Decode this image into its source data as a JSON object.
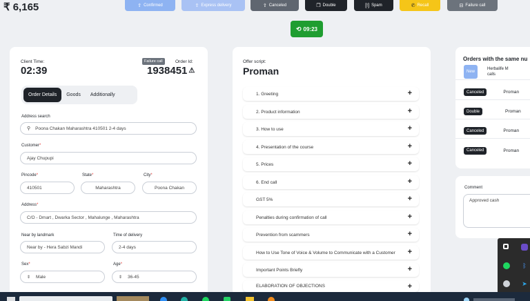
{
  "header": {
    "balance": "₹ 6,165",
    "buttons": {
      "confirmed": {
        "label": "Confirmed",
        "color": "#8eb3f2"
      },
      "express": {
        "label": "Express delivery",
        "color": "#a9c2f4"
      },
      "canceled": {
        "label": "Canceled",
        "color": "#5f6670"
      },
      "double": {
        "label": "Double",
        "color": "#1f2329"
      },
      "spam": {
        "label": "Spam",
        "color": "#1f2329"
      },
      "recall": {
        "label": "Recall",
        "color": "#f5c518"
      },
      "failure": {
        "label": "Failure call",
        "color": "#6c737c"
      }
    },
    "timer": "09:23",
    "timer_color": "#1f9d30"
  },
  "order_card": {
    "client_time_label": "Client Time:",
    "client_time": "02:39",
    "failure_badge": "Failure call",
    "order_id_label": "Order Id:",
    "order_id": "1938451",
    "tabs": [
      "Order Details",
      "Goods",
      "Additionally"
    ],
    "address_search_label": "Address search",
    "address_search_value": "Poona Chakan Maharashtra 410501 2-4 days",
    "customer_label": "Customer",
    "customer_value": "Ajay Chupupi",
    "pincode_label": "Pincode",
    "pincode_value": "410501",
    "state_label": "State",
    "state_value": "Maharashtra",
    "city_label": "City",
    "city_value": "Poona Chakan",
    "address_label": "Address",
    "address_value": "C/O - Dmart , Dwarka Sector , Mahalunge , Maharashtra",
    "landmark_label": "Near by landmark",
    "landmark_value": "Near by - Hera Sabzi Mandi",
    "delivery_label": "Time of delivery",
    "delivery_value": "2-4 days",
    "sex_label": "Sex",
    "sex_value": "Male",
    "age_label": "Age",
    "age_value": "36-45",
    "required_mark": "*"
  },
  "offer_card": {
    "script_label": "Offer script:",
    "product": "Proman",
    "items": [
      "1. Greeting",
      "2. Product information",
      "3. How to use",
      "4. Presentation of the course",
      "5. Prices",
      "6. End call",
      "GST 5%",
      "Penalties during confirmation of call",
      "Prevention from scammers",
      "How to Use Tone of Voice & Volume to Communicate with a Customer",
      "Important Points Briefly",
      "ELABORATION OF OBJECTIONS"
    ],
    "plus_icon": "+"
  },
  "same_number": {
    "title": "Orders with the same nu",
    "rows": [
      {
        "status": "New",
        "product": "Herbalife M calls",
        "color": "#8eb3f2"
      },
      {
        "status": "Canceled",
        "product": "Proman",
        "color": "#1f2329"
      },
      {
        "status": "Double",
        "product": "Proman",
        "color": "#1f2329"
      },
      {
        "status": "Canceled",
        "product": "Proman",
        "color": "#1f2329"
      },
      {
        "status": "Canceled",
        "product": "Proman",
        "color": "#1f2329"
      }
    ]
  },
  "comment": {
    "label": "Comment",
    "value": "Approved cash"
  }
}
